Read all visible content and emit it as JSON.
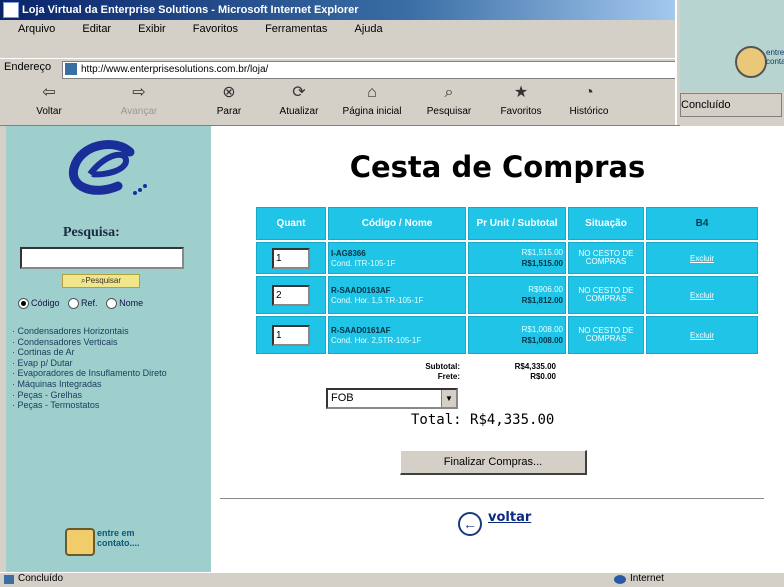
{
  "window": {
    "title": "Loja Virtual da Enterprise Solutions - Microsoft Internet Explorer"
  },
  "menu": [
    "Arquivo",
    "Editar",
    "Exibir",
    "Favoritos",
    "Ferramentas",
    "Ajuda"
  ],
  "address": {
    "label": "Endereço",
    "url": "http://www.enterprisesolutions.com.br/loja/"
  },
  "toolbar": {
    "back": "Voltar",
    "forward": "Avançar",
    "stop": "Parar",
    "refresh": "Atualizar",
    "home": "Página inicial",
    "search": "Pesquisar",
    "favorites": "Favoritos",
    "history": "Histórico"
  },
  "second_window": {
    "status": "Concluído",
    "logo_text": "entre em contato..."
  },
  "sidebar": {
    "search_label": "Pesquisa:",
    "search_value": "",
    "search_button": "Pesquisar",
    "radio_options": [
      "Código",
      "Ref.",
      "Nome"
    ],
    "categories": [
      "Condensadores Horizontais",
      "Condensadores Verticais",
      "Cortinas de Ar",
      "Evap p/ Dutar",
      "Evaporadores de Insuflamento Direto",
      "Máquinas Integradas",
      "Peças - Grelhas",
      "Peças - Termostatos"
    ],
    "contact_text": "entre em contato...."
  },
  "page": {
    "heading": "Cesta de Compras"
  },
  "cart": {
    "headers": [
      "Quant",
      "Código / Nome",
      "Pr Unit / Subtotal",
      "Situação",
      "B4"
    ],
    "rows": [
      {
        "qty": "1",
        "code": "I-AG8366",
        "name": "Cond. ITR-105-1F",
        "unit": "R$1,515.00",
        "subtotal": "R$1,515.00",
        "status": "NO CESTO DE COMPRAS",
        "action": "Excluir"
      },
      {
        "qty": "2",
        "code": "R-SAAD0163AF",
        "name": "Cond. Hor. 1,5 TR-105-1F",
        "unit": "R$906.00",
        "subtotal": "R$1,812.00",
        "status": "NO CESTO DE COMPRAS",
        "action": "Excluir"
      },
      {
        "qty": "1",
        "code": "R-SAAD0161AF",
        "name": "Cond. Hor. 2,5TR-105-1F",
        "unit": "R$1,008.00",
        "subtotal": "R$1,008.00",
        "status": "NO CESTO DE COMPRAS",
        "action": "Excluir"
      }
    ]
  },
  "summary": {
    "subtotal_label": "Subtotal:",
    "subtotal": "R$4,335.00",
    "frete_label": "Frete:",
    "frete": "R$0.00",
    "shipping_option": "FOB",
    "total_label": "Total:",
    "total": "R$4,335.00"
  },
  "actions": {
    "finalize": "Finalizar Compras...",
    "back": "voltar"
  },
  "statusbar": {
    "text": "Concluído",
    "zone": "Internet"
  }
}
